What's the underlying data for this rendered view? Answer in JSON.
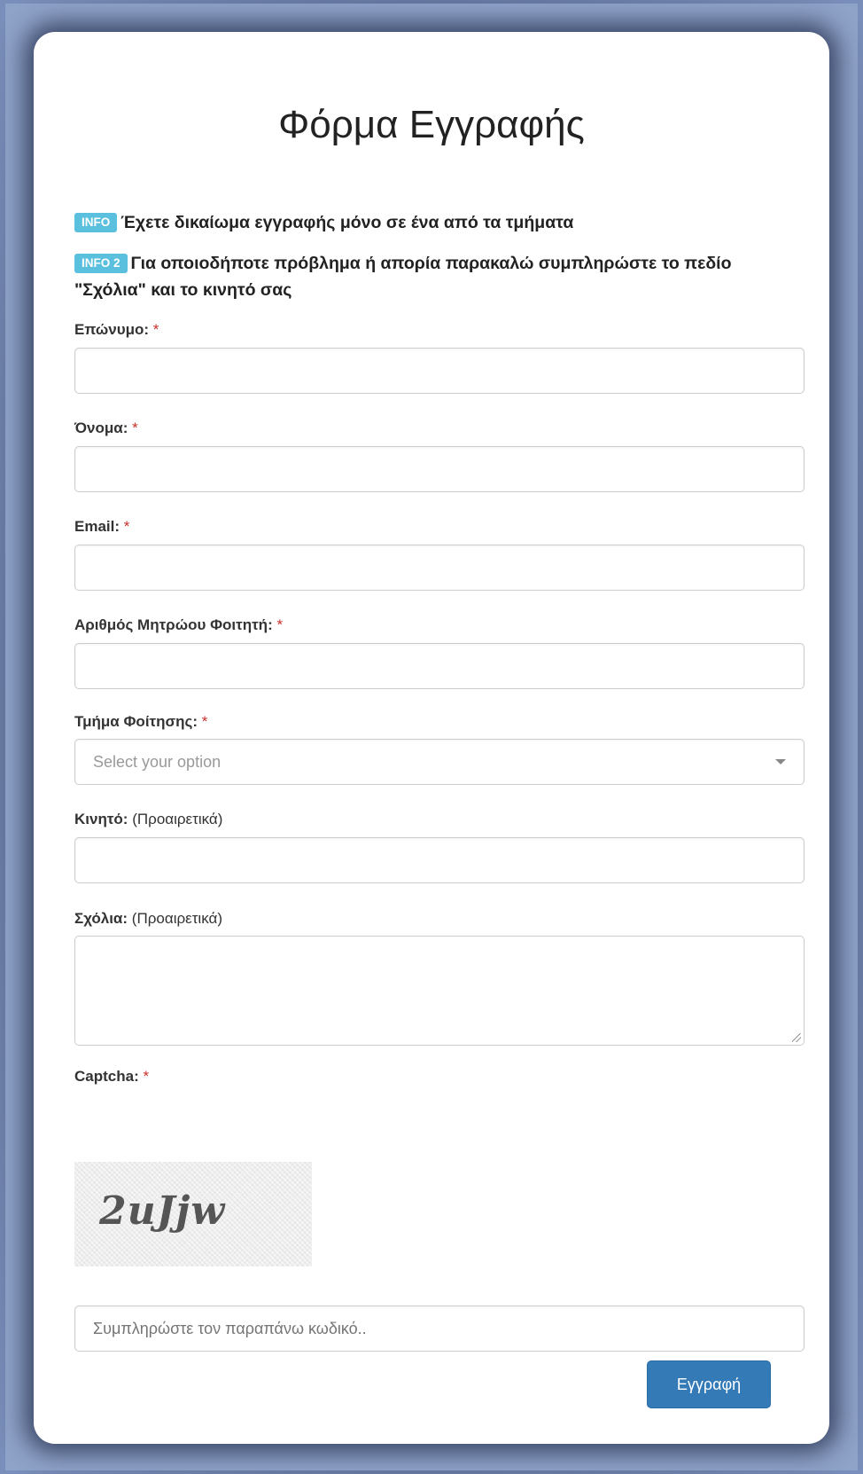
{
  "form": {
    "title": "Φόρμα Εγγραφής",
    "info1": {
      "badge": "INFO",
      "text": "Έχετε δικαίωμα εγγραφής μόνο σε ένα από τα τμήματα"
    },
    "info2": {
      "badge": "INFO 2",
      "text": "Για οποιοδήποτε πρόβλημα ή απορία παρακαλώ συμπληρώστε το πεδίο \"Σχόλια\" και το κινητό σας"
    },
    "required_mark": "*",
    "fields": {
      "surname": {
        "label": "Επώνυμο:",
        "value": ""
      },
      "name": {
        "label": "Όνομα:",
        "value": ""
      },
      "email": {
        "label": "Email:",
        "value": ""
      },
      "student_id": {
        "label": "Αριθμός Μητρώου Φοιτητή:",
        "value": ""
      },
      "department": {
        "label": "Τμήμα Φοίτησης:",
        "selected": "Select your option"
      },
      "mobile": {
        "label": "Κινητό:",
        "optional": "(Προαιρετικά)",
        "value": ""
      },
      "comments": {
        "label": "Σχόλια:",
        "optional": "(Προαιρετικά)",
        "value": ""
      },
      "captcha": {
        "label": "Captcha:",
        "image_text": "2uJjw",
        "placeholder": "Συμπληρώστε τον παραπάνω κωδικό.."
      }
    },
    "submit_label": "Εγγραφή"
  },
  "colors": {
    "badge": "#5bc0de",
    "primary_button": "#337ab7",
    "required": "#c9302c",
    "background": "#6c7fa5"
  }
}
